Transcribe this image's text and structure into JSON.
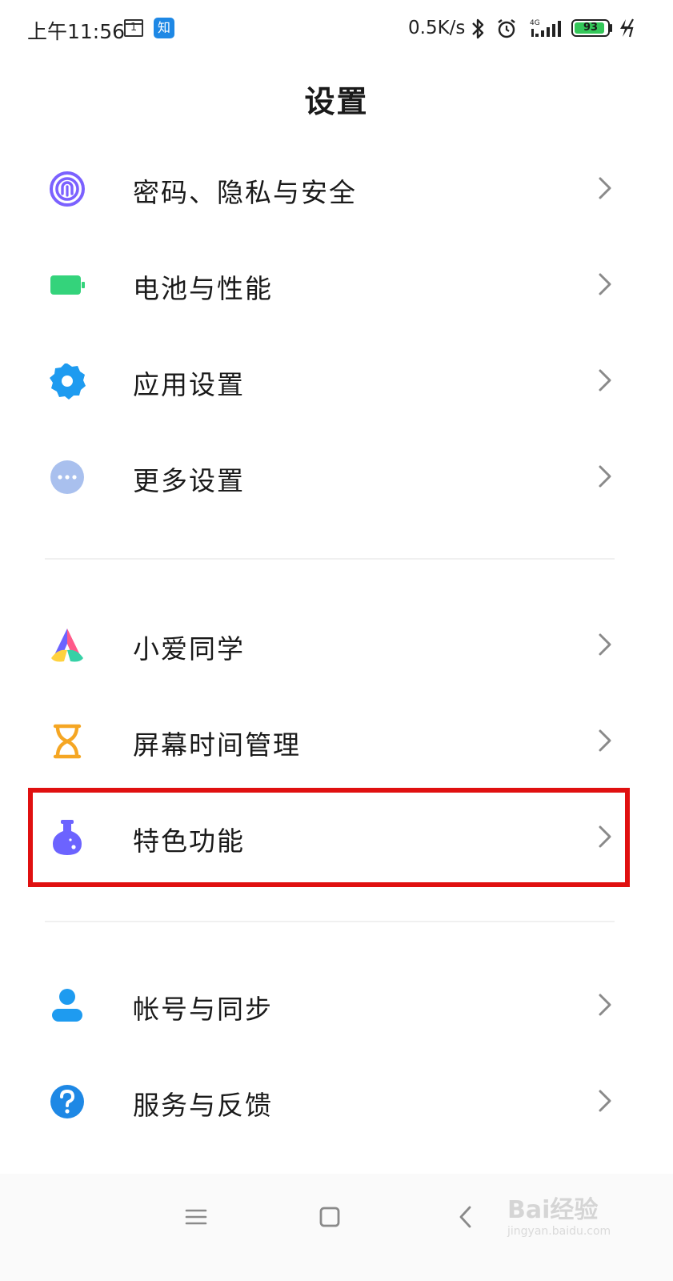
{
  "status_bar": {
    "time": "上午11:56",
    "calendar_day": "1",
    "notification_app": "知",
    "net_speed": "0.5K/s",
    "network_type": "4G",
    "battery_level": "93",
    "battery_percent": 93
  },
  "header": {
    "title": "设置"
  },
  "menu": {
    "items": [
      {
        "label": "密码、隐私与安全",
        "icon": "fingerprint-icon"
      },
      {
        "label": "电池与性能",
        "icon": "battery-icon"
      },
      {
        "label": "应用设置",
        "icon": "gear-icon"
      },
      {
        "label": "更多设置",
        "icon": "more-dots-icon"
      },
      {
        "label": "小爱同学",
        "icon": "xiaoai-icon"
      },
      {
        "label": "屏幕时间管理",
        "icon": "hourglass-icon"
      },
      {
        "label": "特色功能",
        "icon": "flask-icon"
      },
      {
        "label": "帐号与同步",
        "icon": "account-icon"
      },
      {
        "label": "服务与反馈",
        "icon": "help-icon"
      }
    ]
  },
  "watermark": {
    "brand": "Bai经验",
    "url": "jingyan.baidu.com"
  },
  "colors": {
    "highlight": "#e01010",
    "fingerprint": "#7b61ff",
    "battery": "#34d37b",
    "gear": "#1e9bf0",
    "more": "#a9c0ee",
    "hourglass": "#f5a623",
    "flask": "#6c63ff",
    "account": "#1e9bf0",
    "help": "#1e88e5"
  }
}
